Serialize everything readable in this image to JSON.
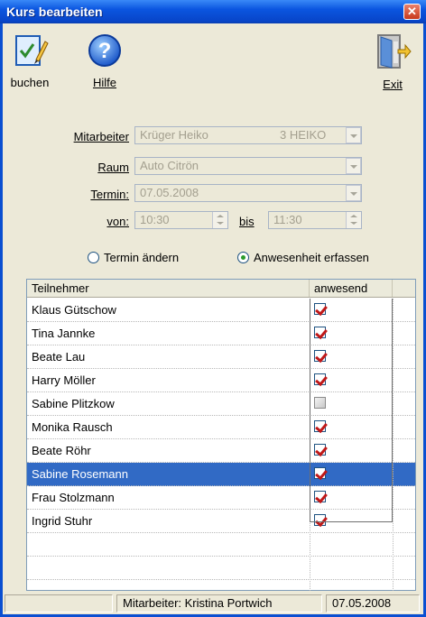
{
  "window": {
    "title": "Kurs bearbeiten",
    "close_glyph": "✕"
  },
  "toolbar": {
    "buchen": "buchen",
    "hilfe": "Hilfe",
    "exit": "Exit"
  },
  "form": {
    "mitarbeiter_label": "Mitarbeiter",
    "mitarbeiter_value": "Krüger Heiko",
    "mitarbeiter_code": "3 HEIKO",
    "raum_label": "Raum",
    "raum_value": "Auto Citrön",
    "termin_label": "Termin:",
    "termin_value": "07.05.2008",
    "von_label": "von:",
    "von_value": "10:30",
    "bis_label": "bis",
    "bis_value": "11:30"
  },
  "mode": {
    "termin_aendern": "Termin ändern",
    "anwesenheit_erfassen": "Anwesenheit erfassen",
    "selected": "anwesenheit_erfassen"
  },
  "grid": {
    "col_teilnehmer": "Teilnehmer",
    "col_anwesend": "anwesend",
    "rows": [
      {
        "name": "Klaus Gütschow",
        "anwesend": true
      },
      {
        "name": "Tina Jannke",
        "anwesend": true
      },
      {
        "name": "Beate Lau",
        "anwesend": true
      },
      {
        "name": "Harry Möller",
        "anwesend": true
      },
      {
        "name": "Sabine Plitzkow",
        "anwesend": false
      },
      {
        "name": "Monika Rausch",
        "anwesend": true
      },
      {
        "name": "Beate Röhr",
        "anwesend": true
      },
      {
        "name": "Sabine Rosemann",
        "anwesend": true,
        "selected": true
      },
      {
        "name": "Frau Stolzmann",
        "anwesend": true
      },
      {
        "name": "Ingrid Stuhr",
        "anwesend": true
      }
    ]
  },
  "status": {
    "mitarbeiter": "Mitarbeiter:  Kristina Portwich",
    "date": "07.05.2008"
  },
  "icons": {
    "buchen": "edit-document-icon",
    "hilfe": "help-icon",
    "exit": "exit-door-icon"
  },
  "colors": {
    "titlebar": "#0b55e0",
    "selection": "#316ac5",
    "check": "#c01818",
    "window_bg": "#ece9d8"
  }
}
